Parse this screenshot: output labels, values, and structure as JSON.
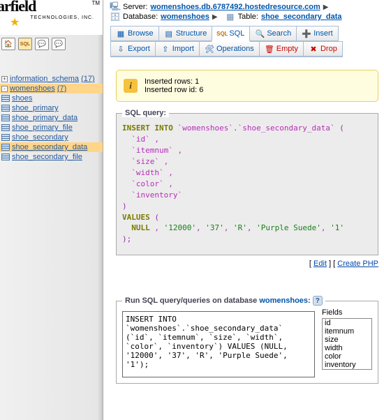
{
  "logo": {
    "brand": "arfield",
    "tm": "TM",
    "sub": "TECHNOLOGIES, INC."
  },
  "breadcrumb": {
    "server_label": "Server:",
    "server": "womenshoes.db.6787492.hostedresource.com",
    "db_label": "Database:",
    "db": "womenshoes",
    "table_label": "Table:",
    "table": "shoe_secondary_data"
  },
  "tabs": {
    "browse": "Browse",
    "structure": "Structure",
    "sql": "SQL",
    "search": "Search",
    "insert": "Insert"
  },
  "actions": {
    "export": "Export",
    "import": "Import",
    "operations": "Operations",
    "empty": "Empty",
    "drop": "Drop"
  },
  "tree": {
    "db1": {
      "name": "information_schema",
      "count": "(17)"
    },
    "db2": {
      "name": "womenshoes",
      "count": "(7)"
    },
    "tables": [
      "shoes",
      "shoe_primary",
      "shoe_primary_data",
      "shoe_primary_file",
      "shoe_secondary",
      "shoe_secondary_data",
      "shoe_secondary_file"
    ]
  },
  "notice": {
    "line1": "Inserted rows: 1",
    "line2": "Inserted row id: 6"
  },
  "sql_query": {
    "legend": "SQL query:",
    "kw_insert": "INSERT INTO",
    "db": "`womenshoes`",
    "dot": ".",
    "tbl": "`shoe_secondary_data`",
    "open": " (",
    "cols": [
      "`id`",
      "`itemnum`",
      "`size`",
      "`width`",
      "`color`",
      "`inventory`"
    ],
    "close_paren": ")",
    "kw_values": "VALUES",
    "vals_open": " (",
    "null": "NULL",
    "vals": [
      "'12000'",
      "'37'",
      "'R'",
      "'Purple Suede'",
      "'1'"
    ],
    "semi": ";"
  },
  "code_links": {
    "edit": "Edit",
    "create": "Create PHP"
  },
  "run_query": {
    "legend_prefix": "Run SQL query/queries on database ",
    "dbname": "womenshoes",
    "colon": ":",
    "textarea": "INSERT INTO `womenshoes`.`shoe_secondary_data` (`id`, `itemnum`, `size`, `width`, `color`, `inventory`) VALUES (NULL, '12000', '37', 'R', 'Purple Suede', '1');",
    "fields_hdr": "Fields",
    "fields": [
      "id",
      "itemnum",
      "size",
      "width",
      "color",
      "inventory"
    ]
  }
}
